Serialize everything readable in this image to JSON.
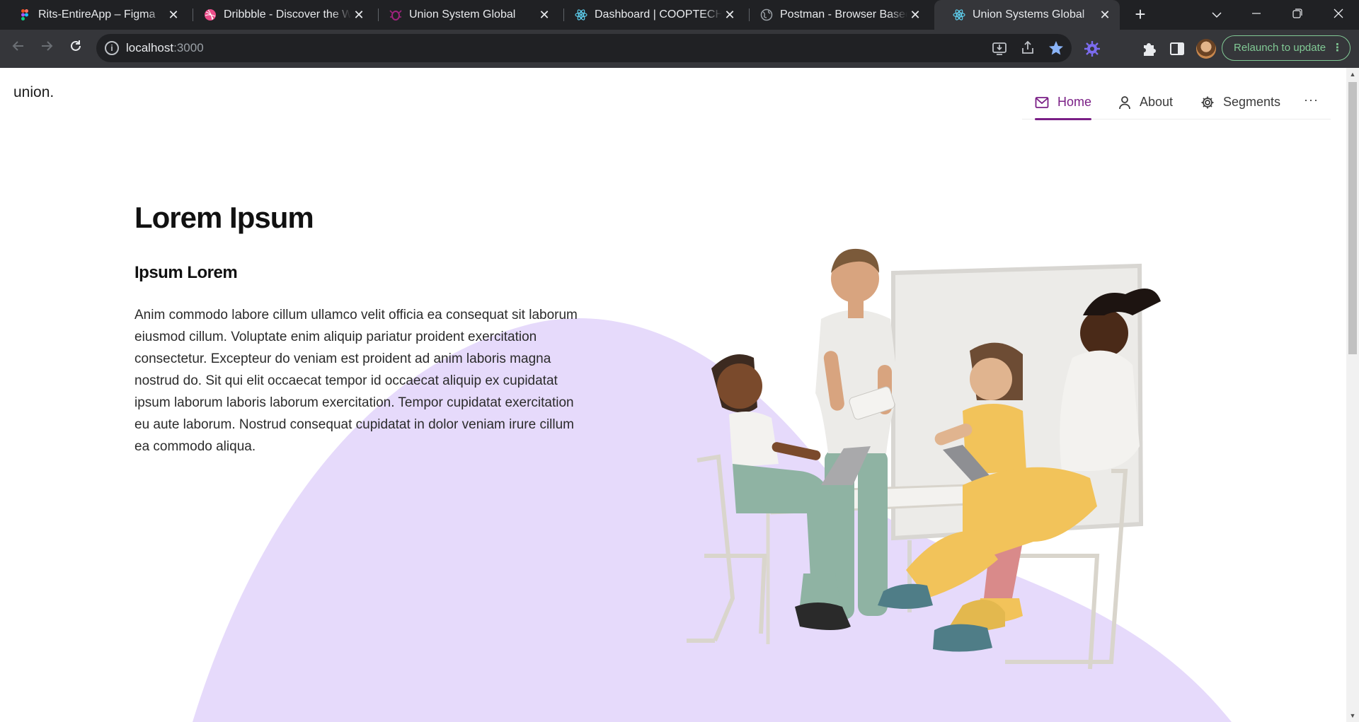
{
  "browser": {
    "tabs": [
      {
        "title": "Rits-EntireApp – Figma",
        "icon": "figma-icon"
      },
      {
        "title": "Dribbble - Discover the World's",
        "icon": "dribbble-icon"
      },
      {
        "title": "Union System Global",
        "icon": "bug-icon"
      },
      {
        "title": "Dashboard | COOPTECH",
        "icon": "react-icon"
      },
      {
        "title": "Postman - Browser Based API",
        "icon": "globe-icon"
      },
      {
        "title": "Union Systems Global",
        "icon": "react-icon",
        "active": true
      }
    ],
    "url_host": "localhost",
    "url_port": ":3000",
    "relaunch_label": "Relaunch to update"
  },
  "page": {
    "logo": "union.",
    "nav": [
      {
        "label": "Home",
        "icon": "mail-icon",
        "active": true
      },
      {
        "label": "About",
        "icon": "user-icon"
      },
      {
        "label": "Segments",
        "icon": "gear-icon"
      }
    ],
    "nav_more": "···",
    "hero": {
      "title": "Lorem Ipsum",
      "subtitle": "Ipsum Lorem",
      "body": "Anim commodo labore cillum ullamco velit officia ea consequat sit laborum eiusmod cillum. Voluptate enim aliquip pariatur proident exercitation consectetur. Excepteur do veniam est proident ad anim laboris magna nostrud do. Sit qui elit occaecat tempor id occaecat aliquip ex cupidatat ipsum laborum laboris laborum exercitation. Tempor cupidatat exercitation eu aute laborum. Nostrud consequat cupidatat in dolor veniam irure cillum ea commodo aliqua."
    }
  },
  "colors": {
    "accent": "#7a1f86",
    "blob": "#e6dafb",
    "relaunch": "#81c995"
  }
}
